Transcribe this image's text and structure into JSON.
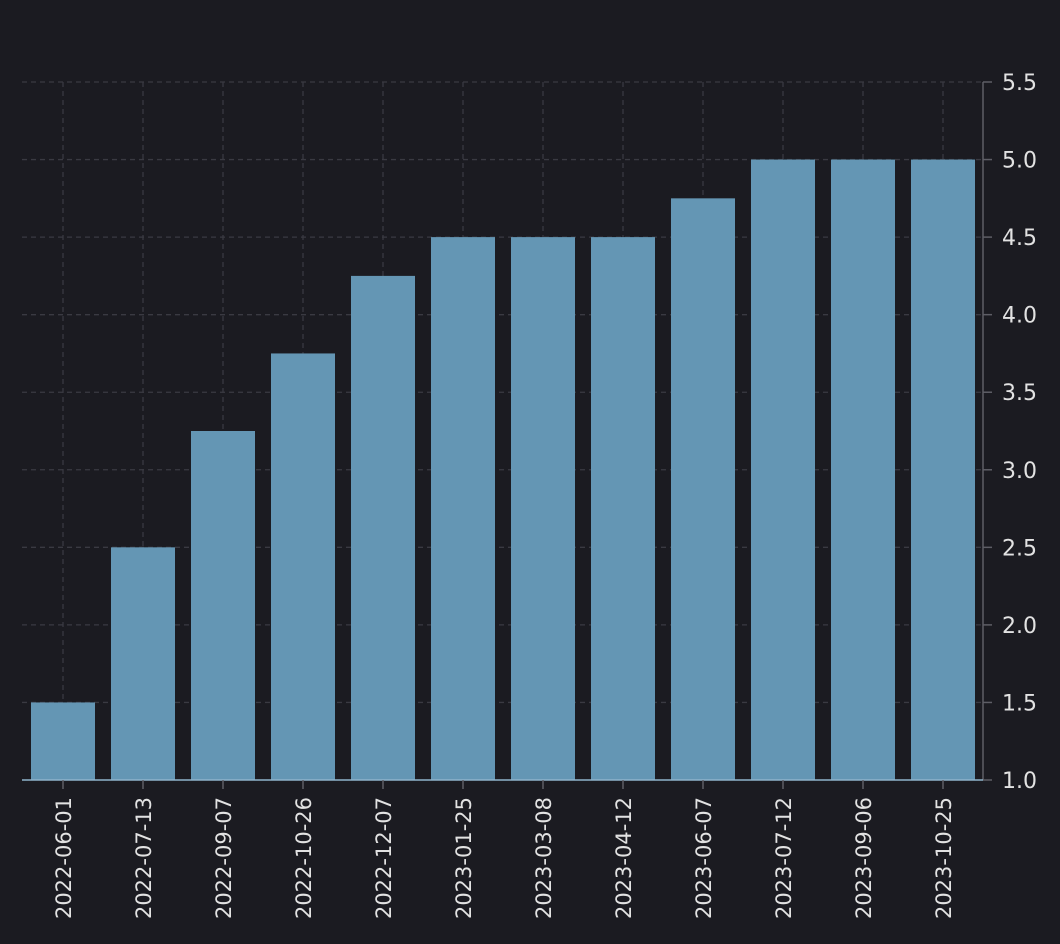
{
  "chart_data": {
    "type": "bar",
    "categories": [
      "2022-06-01",
      "2022-07-13",
      "2022-09-07",
      "2022-10-26",
      "2022-12-07",
      "2023-01-25",
      "2023-03-08",
      "2023-04-12",
      "2023-06-07",
      "2023-07-12",
      "2023-09-06",
      "2023-10-25"
    ],
    "values": [
      1.5,
      2.5,
      3.25,
      3.75,
      4.25,
      4.5,
      4.5,
      4.5,
      4.75,
      5.0,
      5.0,
      5.0
    ],
    "yticks": [
      "1.0",
      "1.5",
      "2.0",
      "2.5",
      "3.0",
      "3.5",
      "4.0",
      "4.5",
      "5.0",
      "5.5"
    ],
    "ylim": [
      1.0,
      5.5
    ],
    "y_axis_side": "right",
    "grid": true,
    "title": "",
    "xlabel": "",
    "ylabel": ""
  },
  "colors": {
    "background": "#1b1b21",
    "bar": "#6496b4",
    "grid": "#3a3a42",
    "axis": "#5e5e66",
    "baseline": "#8fb4cc",
    "tick_text": "#e2e2e2"
  }
}
